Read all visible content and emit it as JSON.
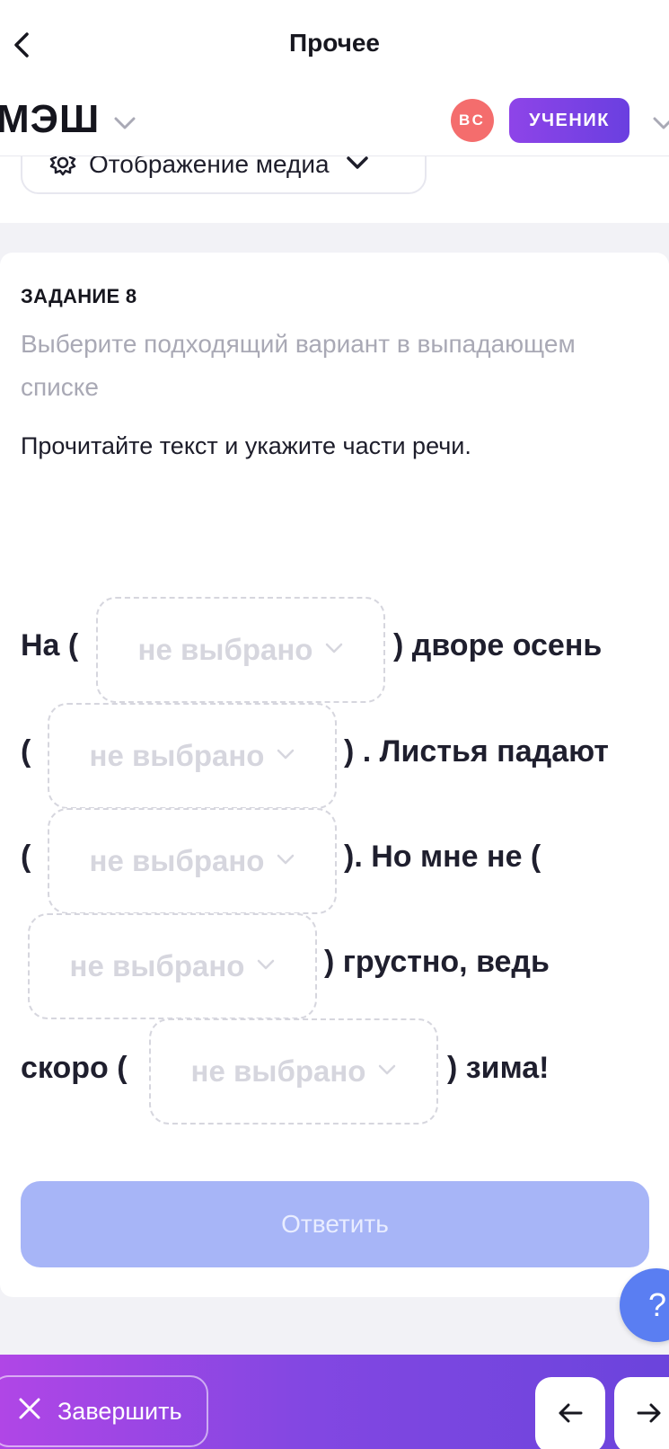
{
  "nav": {
    "title": "Прочее"
  },
  "header": {
    "logo": "МЭШ",
    "avatar_initials": "ВС",
    "role": "УЧЕНИК"
  },
  "media": {
    "label": "Отображение медиа"
  },
  "task": {
    "number_label": "ЗАДАНИЕ 8",
    "hint": "Выберите подходящий вариант в выпадающем списке",
    "instruction": "Прочитайте текст и укажите части речи.",
    "fragments": [
      "На (",
      ") дворе осень",
      "(",
      ") . Листья падают",
      "(",
      "). Но мне не (",
      ") грустно, ведь",
      "скоро (",
      ") зима!"
    ],
    "dropdowns": [
      {
        "value": "не выбрано"
      },
      {
        "value": "не выбрано"
      },
      {
        "value": "не выбрано"
      },
      {
        "value": "не выбрано"
      },
      {
        "value": "не выбрано"
      }
    ],
    "answer_label": "Ответить"
  },
  "help": {
    "label": "?"
  },
  "bottom": {
    "finish_label": "Завершить"
  },
  "colors": {
    "accent": "#6a3fe0",
    "answer_disabled": "#a7b5f7",
    "avatar": "#f46d6d",
    "help": "#5a7ef2"
  }
}
